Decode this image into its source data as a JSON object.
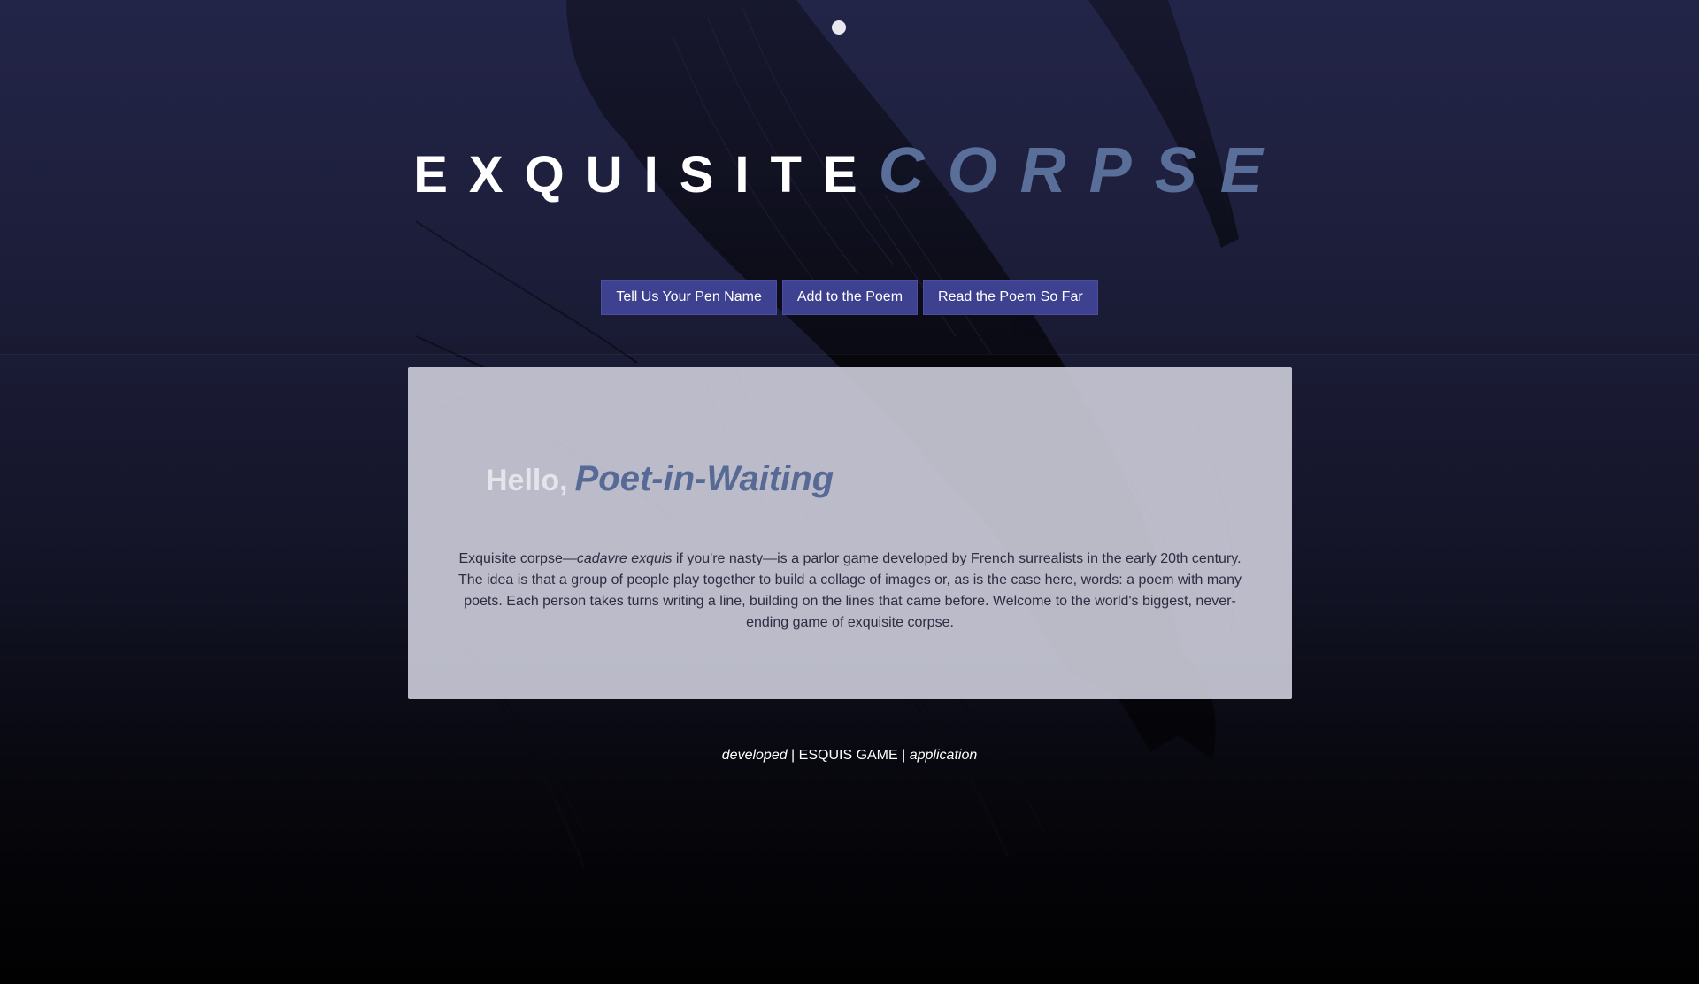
{
  "header": {
    "title_word_1": "EXQUISITE",
    "title_word_2": "CORPSE"
  },
  "nav": {
    "items": [
      {
        "label": "Tell Us Your Pen Name"
      },
      {
        "label": "Add to the Poem"
      },
      {
        "label": "Read the Poem So Far"
      }
    ]
  },
  "main": {
    "greeting": "Hello,",
    "pen_name": "Poet-in-Waiting",
    "intro": {
      "part1": "Exquisite corpse—",
      "emphasis": "cadavre exquis",
      "part2": " if you're nasty—is a parlor game developed by French surrealists in the early 20th century. The idea is that a group of people play together to build a collage of images or, as is the case here, words: a poem with many poets. Each person takes turns writing a line, building on the lines that came before. Welcome to the world's biggest, never-ending game of exquisite corpse."
    }
  },
  "footer": {
    "left": "developed",
    "sep1": " | ",
    "center": "ESQUIS GAME",
    "sep2": " | ",
    "right": "application"
  },
  "colors": {
    "accent": "#5a6e9a",
    "button": "#3e4190",
    "card": "#c8c8d6",
    "bg_top": "#222446",
    "bg_bottom": "#010102"
  },
  "icons": {
    "top_indicator": "dot-icon",
    "background": "bird-engraving-illustration"
  }
}
